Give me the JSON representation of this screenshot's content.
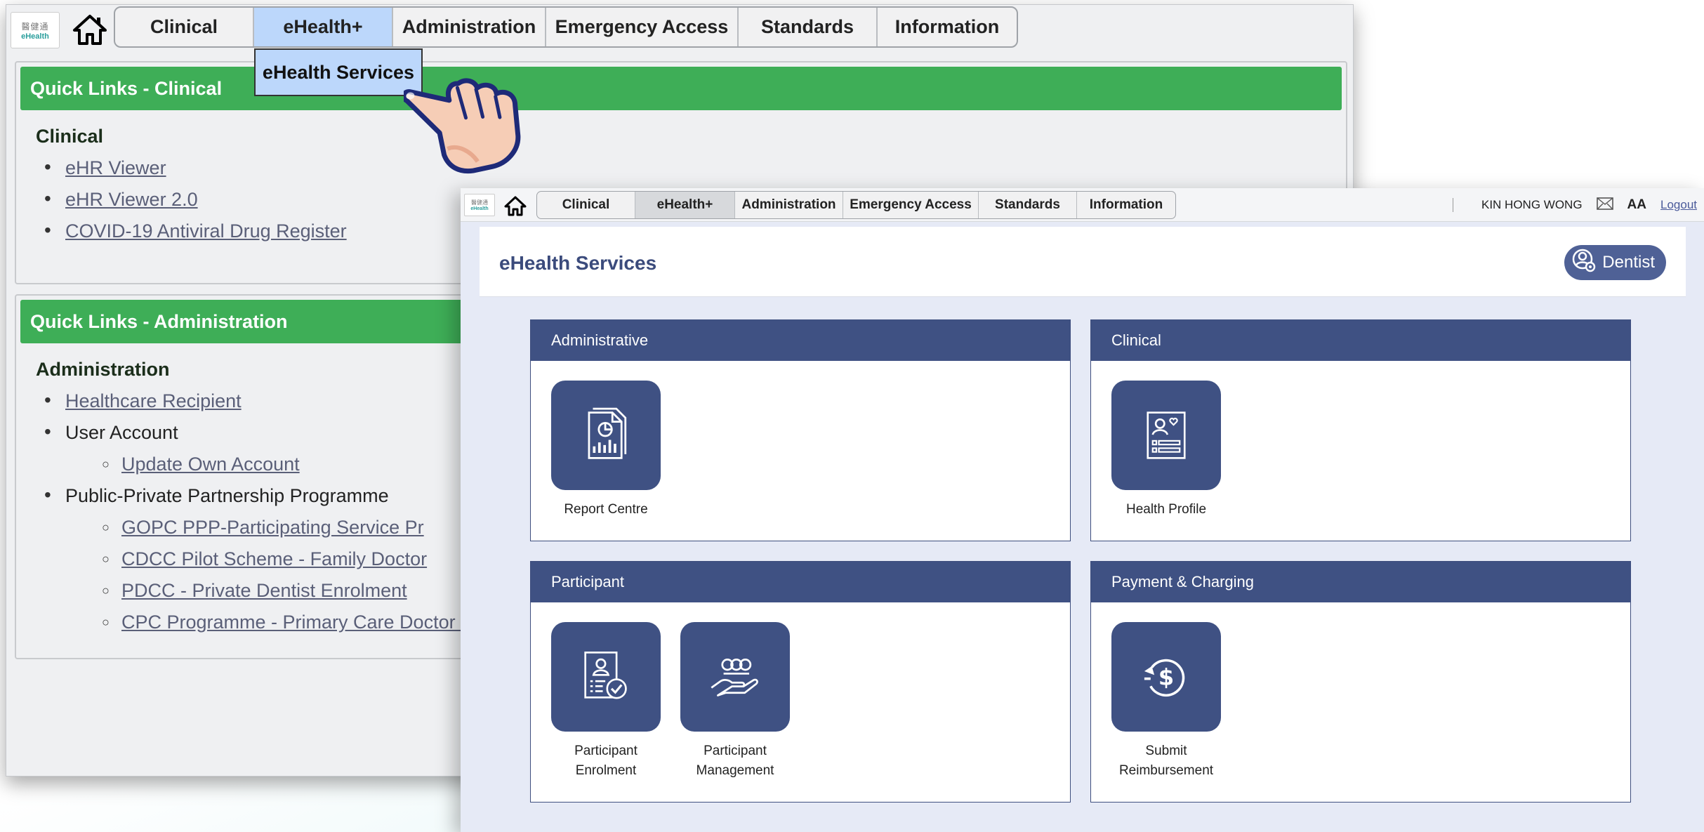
{
  "back": {
    "logo": {
      "line1": "醫健通",
      "line2": "eHealth"
    },
    "nav": [
      "Clinical",
      "eHealth+",
      "Administration",
      "Emergency Access",
      "Standards",
      "Information"
    ],
    "dropdown": "eHealth Services",
    "panel1": {
      "header": "Quick Links - Clinical",
      "section": "Clinical",
      "links": [
        "eHR Viewer",
        "eHR Viewer 2.0",
        "COVID-19 Antiviral Drug Register"
      ]
    },
    "panel2": {
      "header": "Quick Links - Administration",
      "section": "Administration",
      "items": [
        {
          "text": "Healthcare Recipient",
          "link": true,
          "sub": false
        },
        {
          "text": "User Account",
          "link": false,
          "sub": false
        },
        {
          "text": "Update Own Account",
          "link": true,
          "sub": true
        },
        {
          "text": "Public-Private Partnership Programme",
          "link": false,
          "sub": false
        },
        {
          "text": "GOPC PPP-Participating Service Pr",
          "link": true,
          "sub": true
        },
        {
          "text": "CDCC Pilot Scheme - Family Doctor",
          "link": true,
          "sub": true
        },
        {
          "text": "PDCC - Private Dentist Enrolment",
          "link": true,
          "sub": true
        },
        {
          "text": "CPC Programme - Primary Care Doctor E",
          "link": true,
          "sub": true
        }
      ]
    }
  },
  "front": {
    "logo": {
      "line1": "醫健通",
      "line2": "eHealth"
    },
    "nav": [
      "Clinical",
      "eHealth+",
      "Administration",
      "Emergency Access",
      "Standards",
      "Information"
    ],
    "user": {
      "name": "KIN HONG WONG",
      "font_size_label": "AA",
      "logout": "Logout"
    },
    "page_title": "eHealth Services",
    "role": "Dentist",
    "cards": [
      {
        "title": "Administrative",
        "tiles": [
          {
            "label": "Report Centre",
            "icon": "report-icon"
          }
        ]
      },
      {
        "title": "Clinical",
        "tiles": [
          {
            "label": "Health Profile",
            "icon": "health-profile-icon"
          }
        ]
      },
      {
        "title": "Participant",
        "tiles": [
          {
            "label": "Participant Enrolment",
            "icon": "enrolment-icon"
          },
          {
            "label": "Participant Management",
            "icon": "management-icon"
          }
        ]
      },
      {
        "title": "Payment & Charging",
        "tiles": [
          {
            "label": "Submit Reimbursement",
            "icon": "reimbursement-icon"
          }
        ]
      }
    ]
  },
  "colors": {
    "green_header": "#3eae57",
    "navy": "#3f5183",
    "dropdown_blue": "#bcd7fb"
  }
}
